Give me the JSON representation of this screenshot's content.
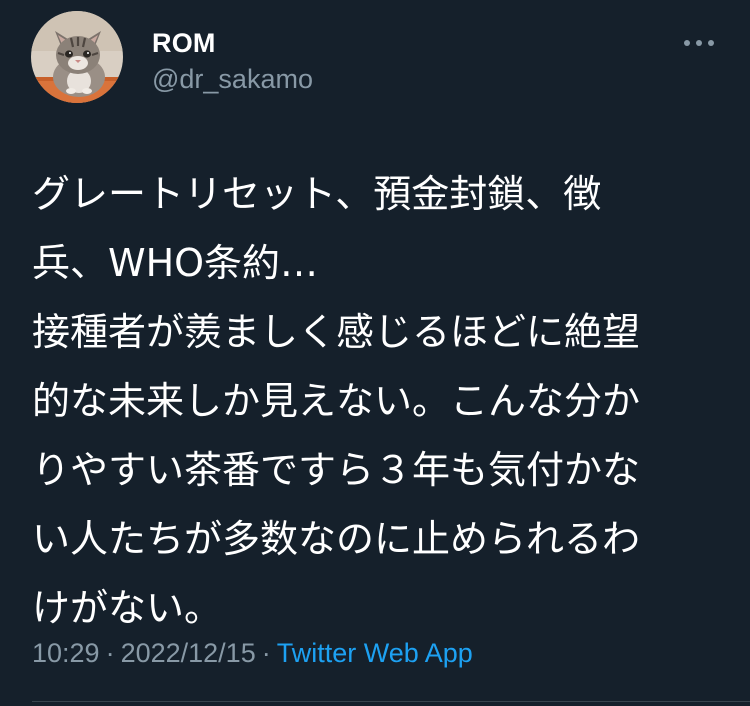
{
  "author": {
    "name": "ROM",
    "handle": "@dr_sakamo",
    "avatar_icon": "cat-avatar"
  },
  "more_icon": "more-horizontal-icon",
  "tweet": {
    "lines": [
      "グレートリセット、預金封鎖、徴",
      "兵、WHO条約…",
      "接種者が羨ましく感じるほどに絶望",
      "的な未来しか見えない。こんな分か",
      "りやすい茶番ですら３年も気付かな",
      "い人たちが多数なのに止められるわ",
      "けがない。"
    ]
  },
  "meta": {
    "time": "10:29",
    "separator": "·",
    "date": "2022/12/15",
    "source": "Twitter Web App"
  },
  "colors": {
    "background": "#15202b",
    "text_primary": "#ffffff",
    "text_secondary": "#8899a6",
    "accent": "#1da1f2",
    "divider": "#38444d"
  }
}
